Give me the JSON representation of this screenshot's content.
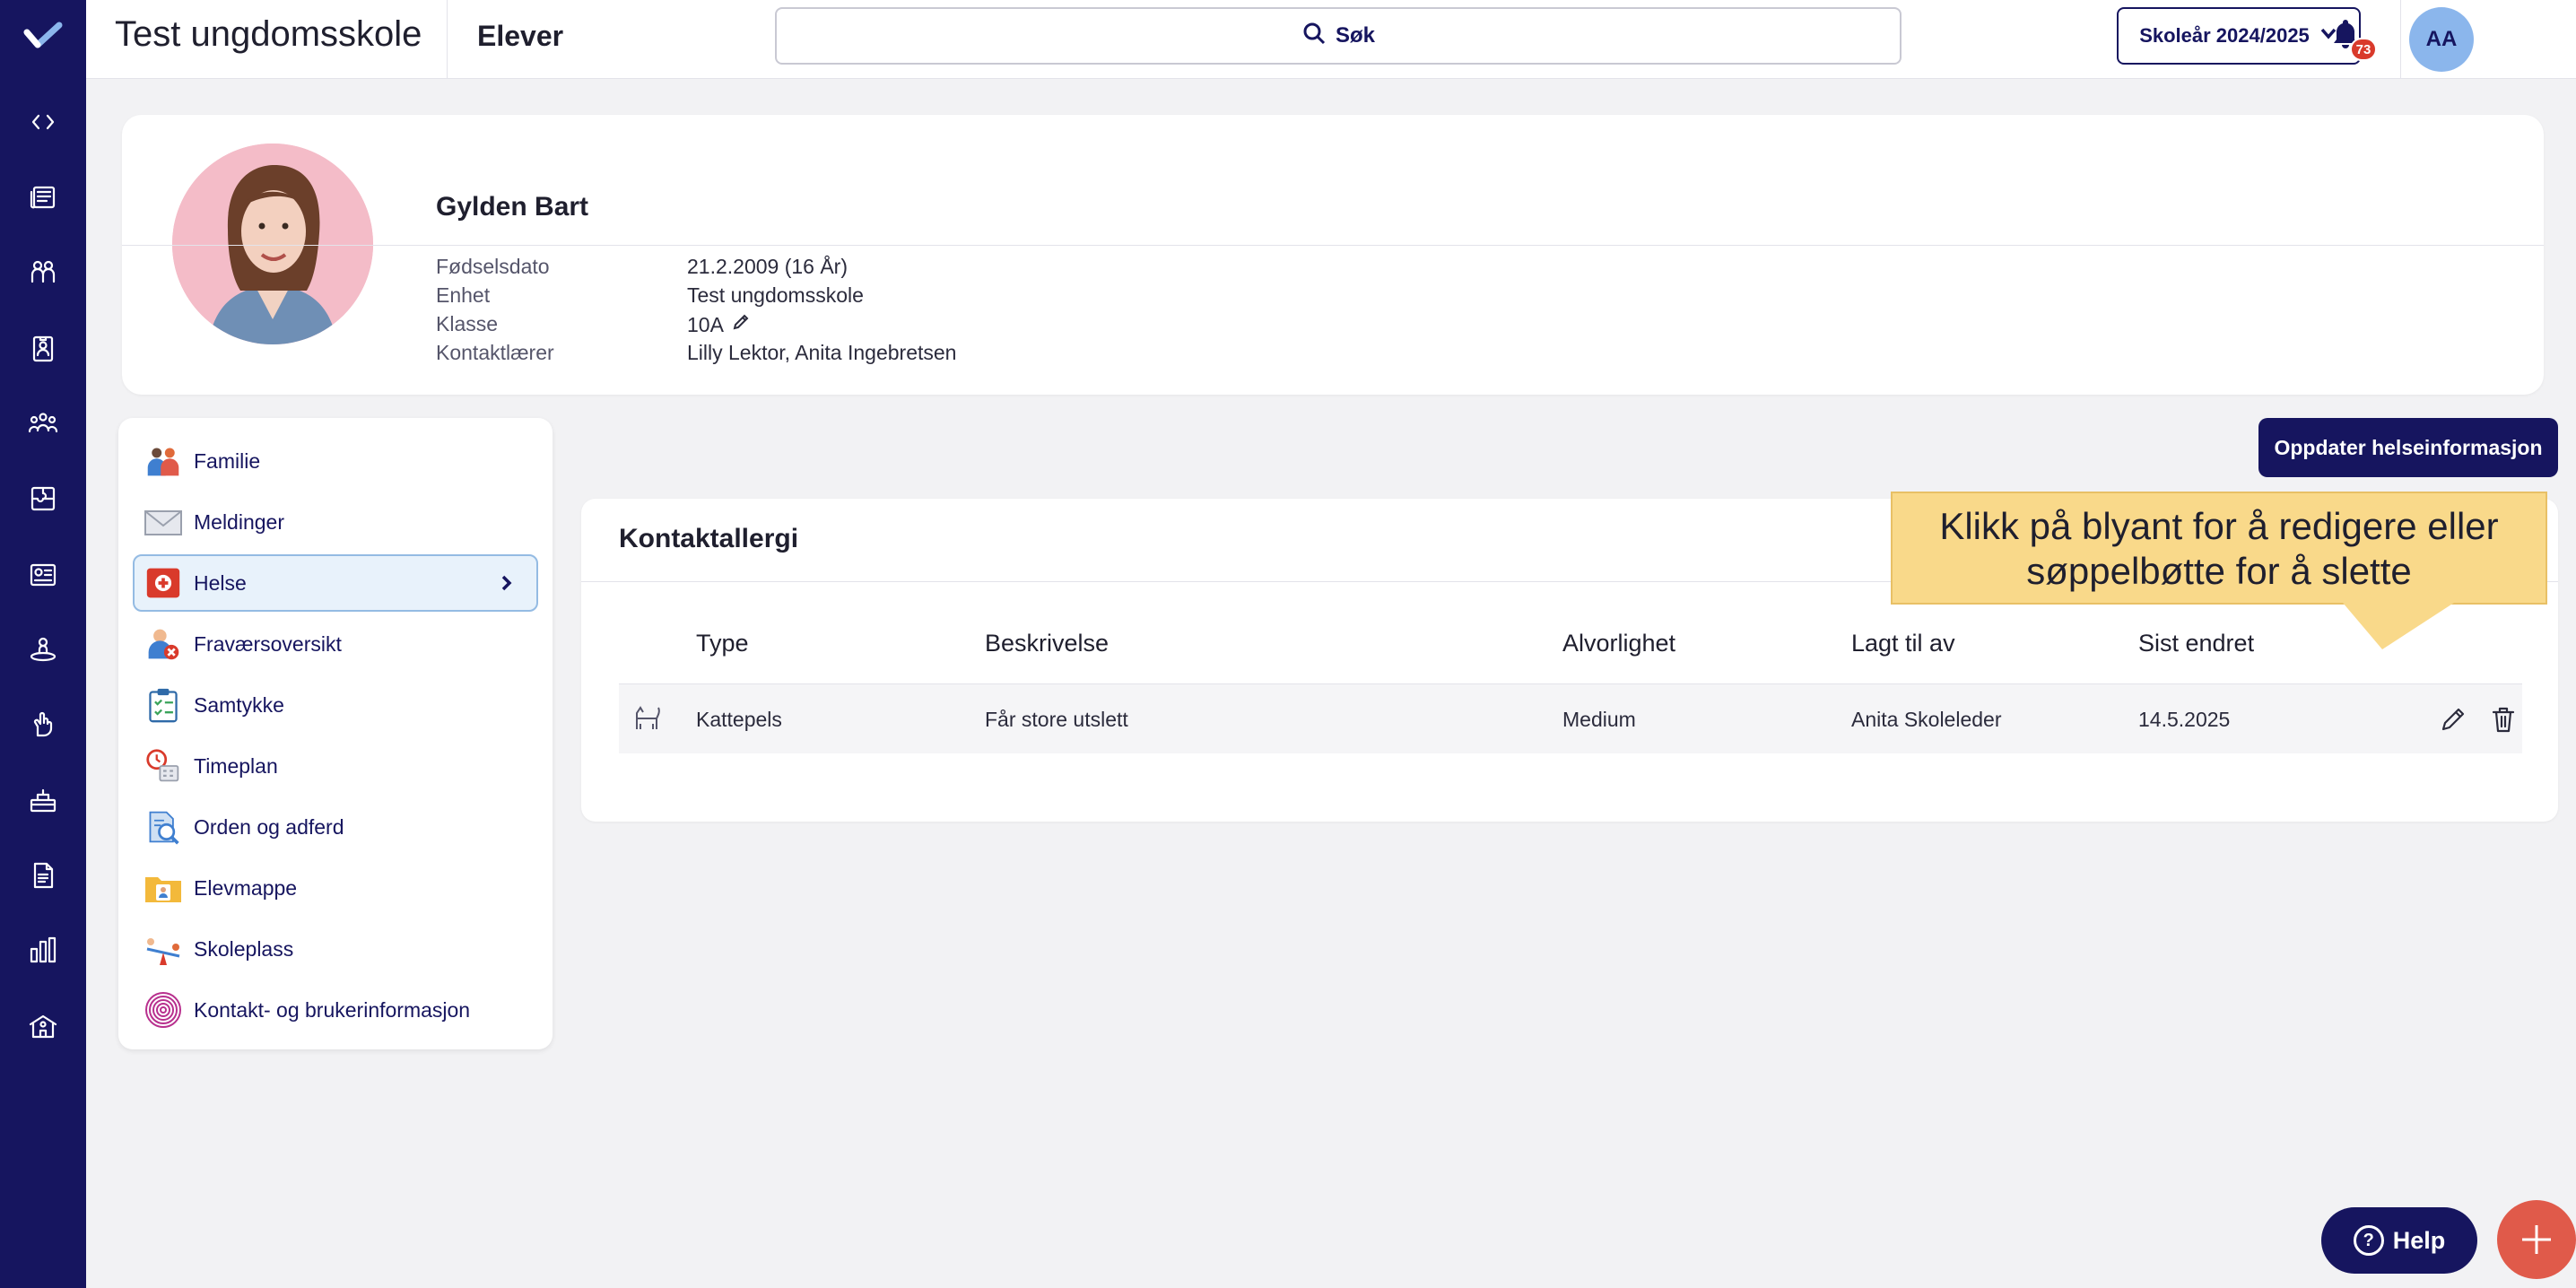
{
  "header": {
    "school_title": "Test ungdomsskole",
    "section_title": "Elever",
    "search_label": "Søk",
    "school_year": "Skoleår 2024/2025",
    "notification_count": "73",
    "user_initials": "AA"
  },
  "profile": {
    "name": "Gylden Bart",
    "fields": [
      {
        "label": "Fødselsdato",
        "value": "21.2.2009 (16 År)"
      },
      {
        "label": "Enhet",
        "value": "Test ungdomsskole"
      },
      {
        "label": "Klasse",
        "value": "10A"
      },
      {
        "label": "Kontaktlærer",
        "value": "Lilly Lektor, Anita Ingebretsen"
      }
    ]
  },
  "menu": {
    "items": [
      {
        "label": "Familie",
        "icon": "family-icon"
      },
      {
        "label": "Meldinger",
        "icon": "envelope-icon"
      },
      {
        "label": "Helse",
        "icon": "health-icon",
        "active": true
      },
      {
        "label": "Fraværsoversikt",
        "icon": "absence-icon"
      },
      {
        "label": "Samtykke",
        "icon": "clipboard-icon"
      },
      {
        "label": "Timeplan",
        "icon": "schedule-icon"
      },
      {
        "label": "Orden og adferd",
        "icon": "conduct-icon"
      },
      {
        "label": "Elevmappe",
        "icon": "folder-icon"
      },
      {
        "label": "Skoleplass",
        "icon": "seesaw-icon"
      },
      {
        "label": "Kontakt- og brukerinformasjon",
        "icon": "fingerprint-icon"
      }
    ]
  },
  "actions": {
    "update_health": "Oppdater helseinformasjon"
  },
  "allergy": {
    "title": "Kontaktallergi",
    "columns": [
      "Type",
      "Beskrivelse",
      "Alvorlighet",
      "Lagt til av",
      "Sist endret"
    ],
    "rows": [
      {
        "type": "Kattepels",
        "description": "Får store utslett",
        "severity": "Medium",
        "added_by": "Anita Skoleleder",
        "modified": "14.5.2025"
      }
    ]
  },
  "tooltip": {
    "line1": "Klikk på blyant for å redigere eller",
    "line2": "søppelbøtte for å slette"
  },
  "help": {
    "label": "Help",
    "icon_glyph": "?"
  },
  "colors": {
    "brand": "#16155f",
    "accent_red": "#e05a4a",
    "tooltip": "#f9d98a"
  }
}
